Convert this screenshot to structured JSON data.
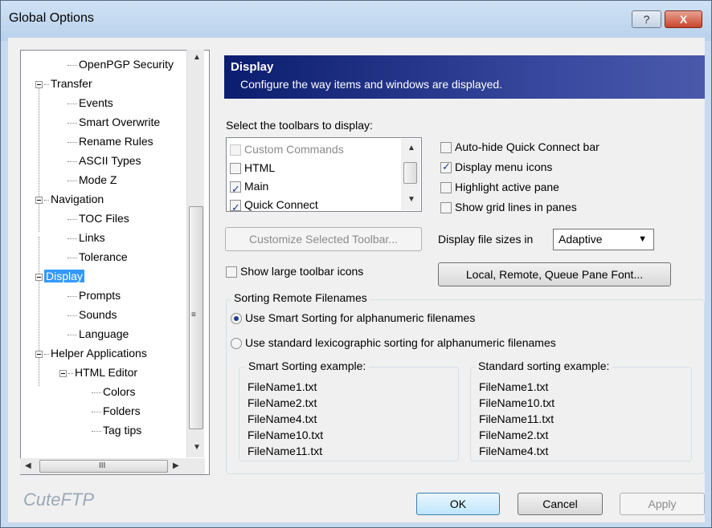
{
  "window": {
    "title": "Global Options",
    "help_label": "?",
    "close_label": "X"
  },
  "tree": {
    "items": [
      {
        "label": "OpenPGP Security",
        "level": 2
      },
      {
        "label": "Transfer",
        "level": 1
      },
      {
        "label": "Events",
        "level": 2
      },
      {
        "label": "Smart Overwrite",
        "level": 2
      },
      {
        "label": "Rename Rules",
        "level": 2
      },
      {
        "label": "ASCII Types",
        "level": 2
      },
      {
        "label": "Mode Z",
        "level": 2
      },
      {
        "label": "Navigation",
        "level": 1
      },
      {
        "label": "TOC Files",
        "level": 2
      },
      {
        "label": "Links",
        "level": 2
      },
      {
        "label": "Tolerance",
        "level": 2
      },
      {
        "label": "Display",
        "level": 1,
        "selected": true
      },
      {
        "label": "Prompts",
        "level": 2
      },
      {
        "label": "Sounds",
        "level": 2
      },
      {
        "label": "Language",
        "level": 2
      },
      {
        "label": "Helper Applications",
        "level": 1
      },
      {
        "label": "HTML Editor",
        "level": 2
      },
      {
        "label": "Colors",
        "level": 3
      },
      {
        "label": "Folders",
        "level": 3
      },
      {
        "label": "Tag tips",
        "level": 3
      }
    ],
    "scroll_h_glyph": "III"
  },
  "banner": {
    "heading": "Display",
    "description": "Configure the way items and windows are displayed."
  },
  "toolbars": {
    "label": "Select the toolbars to display:",
    "items": [
      {
        "label": "Custom Commands",
        "checked": false,
        "disabled": true
      },
      {
        "label": "HTML",
        "checked": false
      },
      {
        "label": "Main",
        "checked": true
      },
      {
        "label": "Quick Connect",
        "checked": true
      }
    ],
    "customize_label": "Customize Selected Toolbar...",
    "large_icons_label": "Show large toolbar icons"
  },
  "options": {
    "autohide_label": "Auto-hide Quick Connect bar",
    "menu_icons_label": "Display menu icons",
    "highlight_label": "Highlight active pane",
    "gridlines_label": "Show grid lines in panes",
    "filesizes_label": "Display file sizes in",
    "filesizes_value": "Adaptive",
    "font_button_label": "Local, Remote, Queue Pane Font..."
  },
  "sorting": {
    "title": "Sorting Remote Filenames",
    "smart_label": "Use Smart Sorting for alphanumeric filenames",
    "standard_label": "Use standard lexicographic sorting for alphanumeric filenames",
    "smart_example_title": "Smart Sorting example:",
    "smart_example": [
      "FileName1.txt",
      "FileName2.txt",
      "FileName4.txt",
      "FileName10.txt",
      "FileName11.txt"
    ],
    "standard_example_title": "Standard sorting example:",
    "standard_example": [
      "FileName1.txt",
      "FileName10.txt",
      "FileName11.txt",
      "FileName2.txt",
      "FileName4.txt"
    ]
  },
  "footer": {
    "brand": "CuteFTP",
    "ok_label": "OK",
    "cancel_label": "Cancel",
    "apply_label": "Apply"
  }
}
